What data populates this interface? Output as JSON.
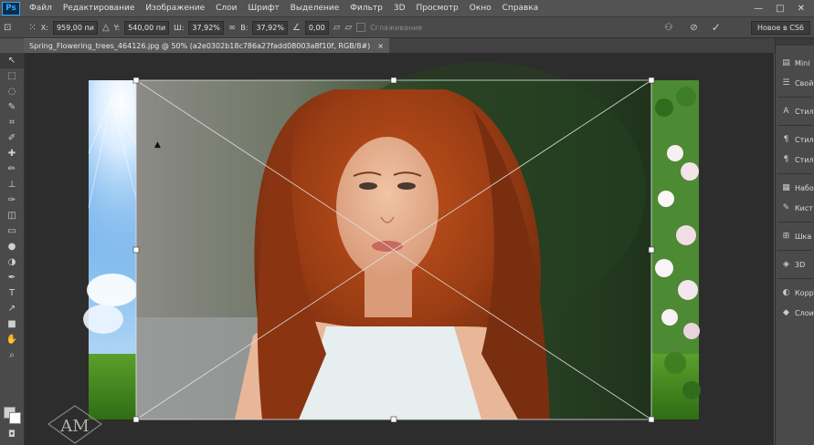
{
  "app": {
    "logo": "Ps"
  },
  "menu": [
    "Файл",
    "Редактирование",
    "Изображение",
    "Слои",
    "Шрифт",
    "Выделение",
    "Фильтр",
    "3D",
    "Просмотр",
    "Окно",
    "Справка"
  ],
  "window_controls": {
    "minimize": "—",
    "maximize": "□",
    "close": "✕"
  },
  "options": {
    "x_label": "X:",
    "x_value": "959,00 пи",
    "y_label": "Y:",
    "y_value": "540,00 пи",
    "w_label": "Ш:",
    "w_value": "37,92%",
    "h_label": "В:",
    "h_value": "37,92%",
    "angle_value": "0,00",
    "antialias_label": "Сглаживание",
    "preset": "Новое в CS6"
  },
  "document_tab": {
    "title": "Spring_Flowering_trees_464126.jpg @ 50% (a2e0302b18c786a27fadd08003a8f10f, RGB/8#)",
    "close": "×"
  },
  "tools": [
    "move-icon",
    "marquee-icon",
    "lasso-icon",
    "quick-select-icon",
    "crop-icon",
    "eyedropper-icon",
    "healing-icon",
    "brush-icon",
    "stamp-icon",
    "history-brush-icon",
    "eraser-icon",
    "gradient-icon",
    "blur-icon",
    "dodge-icon",
    "pen-icon",
    "type-icon",
    "path-select-icon",
    "shape-icon",
    "hand-icon",
    "zoom-icon"
  ],
  "tool_glyphs": [
    "↖",
    "⬚",
    "◌",
    "✎",
    "⌗",
    "✐",
    "✚",
    "✏",
    "⊥",
    "✑",
    "◫",
    "▭",
    "●",
    "◑",
    "✒",
    "T",
    "↗",
    "■",
    "✋",
    "⌕"
  ],
  "dock": [
    {
      "icon": "▤",
      "label": "Mini"
    },
    {
      "icon": "☰",
      "label": "Свой"
    },
    {
      "icon": "A",
      "label": "Стил"
    },
    {
      "icon": "¶",
      "label": "Стил"
    },
    {
      "icon": "¶",
      "label": "Стил"
    },
    {
      "icon": "▦",
      "label": "Набо"
    },
    {
      "icon": "✎",
      "label": "Кист"
    },
    {
      "icon": "⊞",
      "label": "Шка"
    },
    {
      "icon": "◈",
      "label": "3D"
    },
    {
      "icon": "◐",
      "label": "Корр"
    },
    {
      "icon": "◆",
      "label": "Слои"
    }
  ],
  "watermark": "AM",
  "colors": {
    "bg": "#535353",
    "panel": "#4a4a4a",
    "canvas": "#2d2d2d",
    "accent": "#31a8ff"
  }
}
